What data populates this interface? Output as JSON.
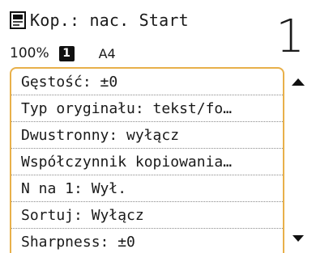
{
  "header": {
    "title": "Kop.: nac. Start",
    "title_icon": "copy-document-icon",
    "zoom": "100%",
    "tray": "1",
    "paper": "A4",
    "copies": "1"
  },
  "settings": [
    {
      "label": "Gęstość: ±0"
    },
    {
      "label": "Typ oryginału: tekst/fo…"
    },
    {
      "label": "Dwustronny: wyłącz"
    },
    {
      "label": "Współczynnik kopiowania…"
    },
    {
      "label": "N na 1: Wył."
    },
    {
      "label": "Sortuj: Wyłącz"
    },
    {
      "label": "Sharpness: ±0"
    }
  ],
  "scroll": {
    "up_icon": "triangle-up-icon",
    "down_icon": "triangle-down-icon"
  },
  "colors": {
    "list_border": "#e8b04a",
    "text": "#1a1a1a"
  }
}
